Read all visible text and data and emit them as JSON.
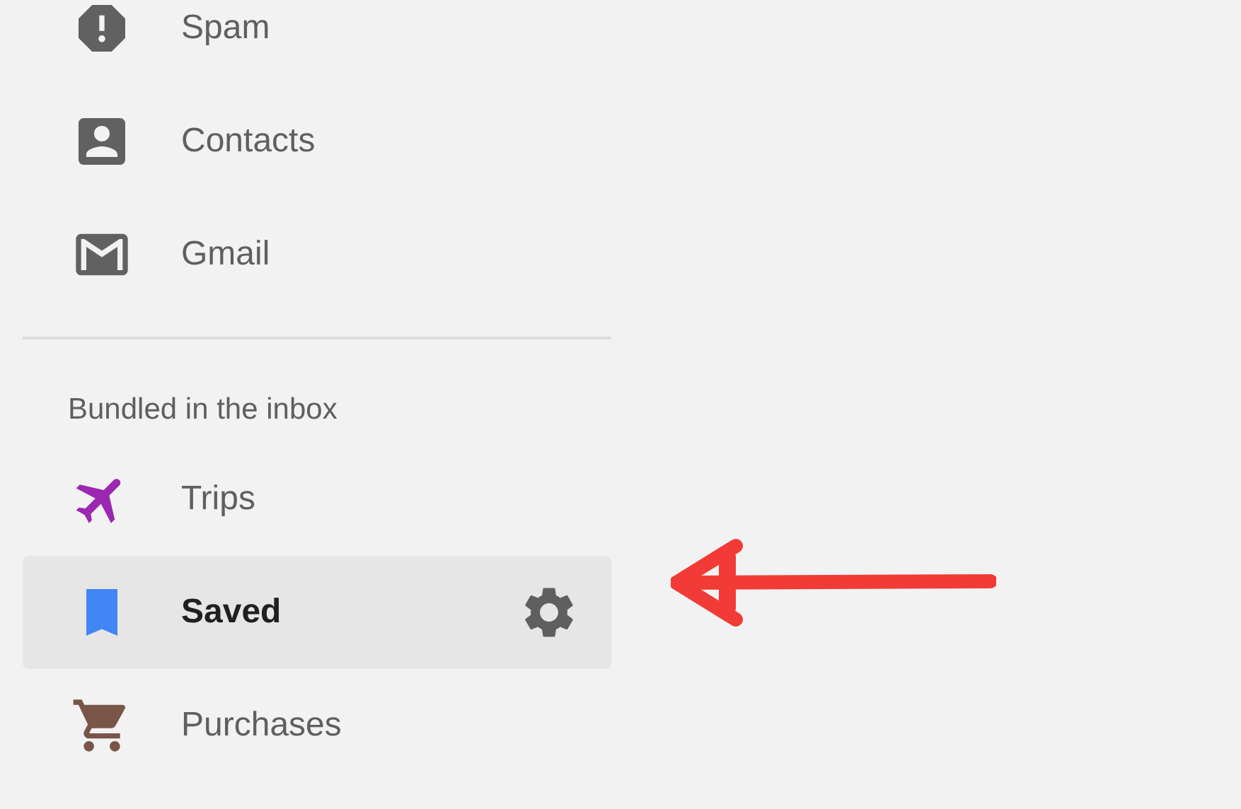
{
  "nav_items": [
    {
      "kind": "spam",
      "label": "Spam"
    },
    {
      "kind": "contacts",
      "label": "Contacts"
    },
    {
      "kind": "mail",
      "label": "Gmail"
    }
  ],
  "bundles": {
    "heading": "Bundled in the inbox",
    "items": [
      {
        "kind": "plane",
        "label": "Trips",
        "color": "#9c27b0",
        "selected": false
      },
      {
        "kind": "bookmark",
        "label": "Saved",
        "color": "#4285f4",
        "selected": true
      },
      {
        "kind": "cart",
        "label": "Purchases",
        "color": "#795548",
        "selected": false
      }
    ]
  }
}
